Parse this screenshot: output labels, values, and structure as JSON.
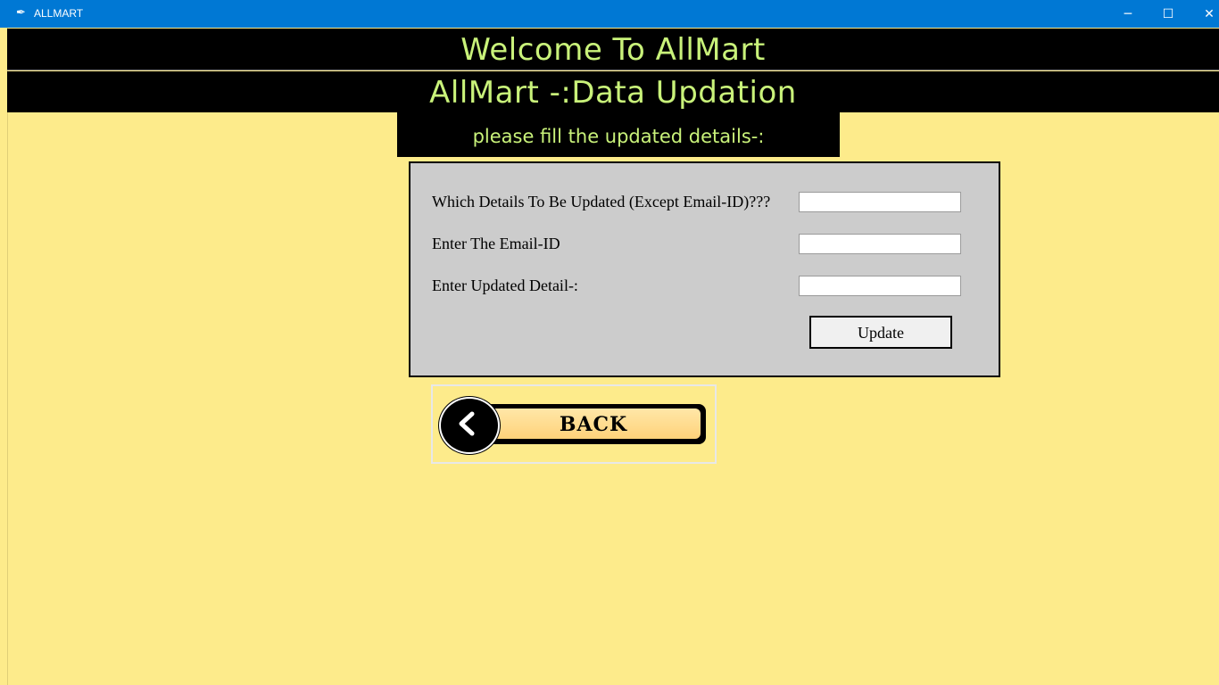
{
  "window": {
    "title": "ALLMART",
    "app_icon": "feather-icon",
    "controls": {
      "minimize": "─",
      "maximize": "☐",
      "close": "✕"
    }
  },
  "header": {
    "welcome": "Welcome To AllMart",
    "page_title": "AllMart -:Data Updation",
    "instruction": "please fill the updated details-:"
  },
  "form": {
    "fields": [
      {
        "label": "Which Details To Be Updated (Except Email-ID)???",
        "value": ""
      },
      {
        "label": "Enter The Email-ID",
        "value": ""
      },
      {
        "label": "Enter Updated Detail-:",
        "value": ""
      }
    ],
    "update_label": "Update"
  },
  "back": {
    "label": "BACK",
    "icon": "chevron-left-icon"
  },
  "colors": {
    "background": "#fdeb8b",
    "header_bg": "#000000",
    "header_text": "#c9f27a",
    "panel_bg": "#cccccc",
    "titlebar": "#0078d4"
  }
}
